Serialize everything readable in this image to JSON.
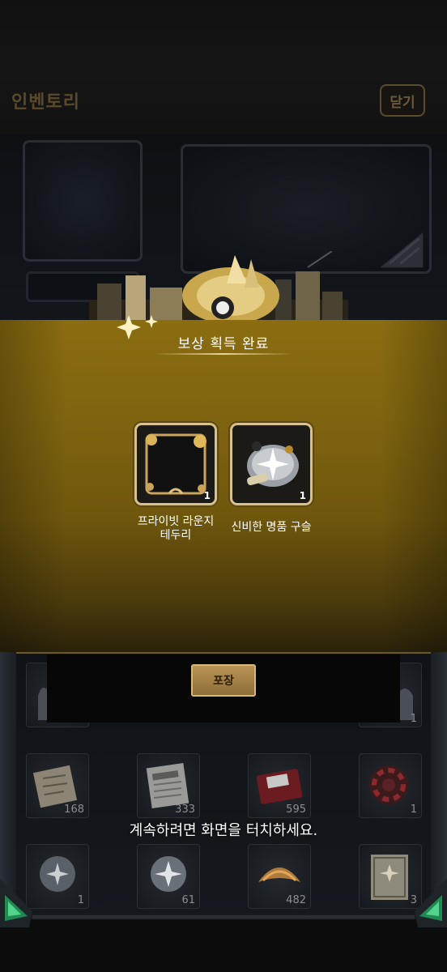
{
  "header": {
    "title": "인벤토리",
    "close_label": "닫기"
  },
  "reward": {
    "title": "보상 획득 완료",
    "items": [
      {
        "name_line1": "프라이빗 라운지",
        "name_line2": "테두리",
        "qty": "1",
        "icon": "frame-border-icon"
      },
      {
        "name_line1": "신비한 명품 구슬",
        "name_line2": "",
        "qty": "1",
        "icon": "mystic-orb-icon"
      }
    ]
  },
  "inventory": {
    "pack_label": "포장",
    "slots_row1": [
      {
        "icon": "statue-icon",
        "count": ""
      },
      {
        "icon": "blank",
        "count": ""
      },
      {
        "icon": "blank",
        "count": ""
      },
      {
        "icon": "trophy-icon",
        "count": "1"
      }
    ],
    "slots_row2": [
      {
        "icon": "map-scroll-icon",
        "count": "168"
      },
      {
        "icon": "newspaper-icon",
        "count": "333"
      },
      {
        "icon": "red-envelope-icon",
        "count": "595"
      },
      {
        "icon": "casino-chip-icon",
        "count": "1"
      }
    ],
    "slots_row3": [
      {
        "icon": "crystal-ball-icon",
        "count": "1"
      },
      {
        "icon": "crystal-ball-sparkle-icon",
        "count": "61"
      },
      {
        "icon": "fortune-cookie-icon",
        "count": "482"
      },
      {
        "icon": "certificate-icon",
        "count": "3"
      }
    ]
  },
  "continue_text": "계속하려면 화면을 터치하세요.",
  "colors": {
    "gold_band": "#8b6d10",
    "card_border": "#d8c18a",
    "pack_button": "#b99456"
  }
}
